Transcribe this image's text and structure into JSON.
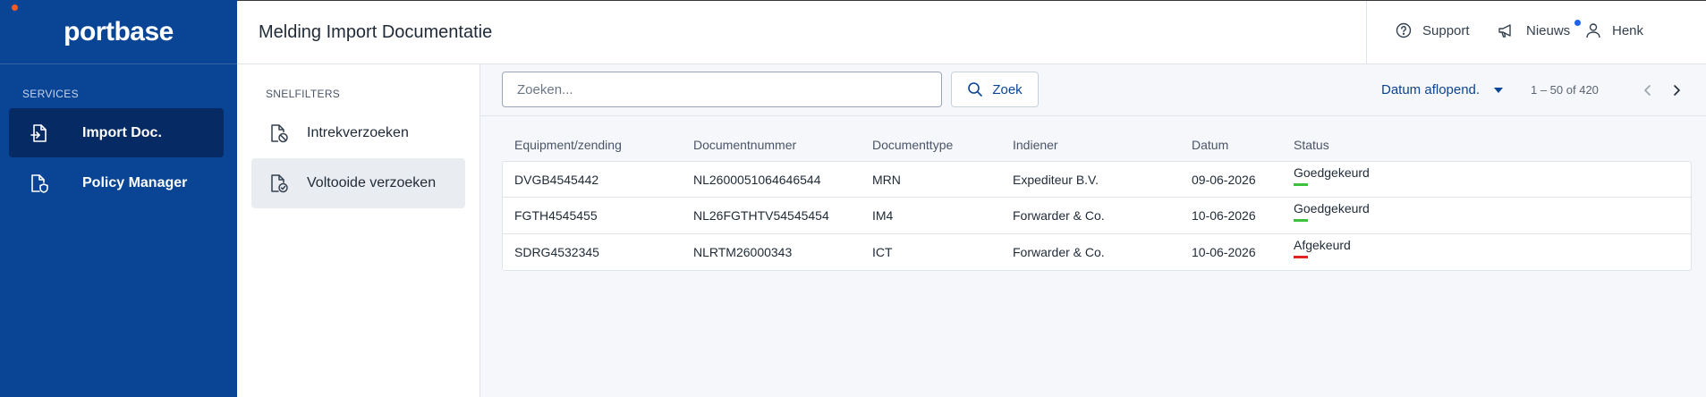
{
  "sidebar": {
    "logo": "portbase",
    "section_label": "SERVICES",
    "items": [
      {
        "label": "Import Doc.",
        "icon": "document-import-icon"
      },
      {
        "label": "Policy Manager",
        "icon": "document-shield-icon"
      }
    ]
  },
  "header": {
    "title": "Melding Import Documentatie",
    "support_label": "Support",
    "news_label": "Nieuws",
    "user_label": "Henk"
  },
  "filters": {
    "title": "SNELFILTERS",
    "items": [
      {
        "label": "Intrekverzoeken",
        "icon": "document-cancel-icon"
      },
      {
        "label": "Voltooide verzoeken",
        "icon": "document-check-icon"
      }
    ]
  },
  "toolbar": {
    "search_placeholder": "Zoeken...",
    "search_button_label": "Zoek",
    "sort_label": "Datum aflopend.",
    "range_text": "1 – 50 of 420"
  },
  "table": {
    "columns": [
      "Equipment/zending",
      "Documentnummer",
      "Documenttype",
      "Indiener",
      "Datum",
      "Status"
    ],
    "rows": [
      {
        "equipment": "DVGB4545442",
        "document_number": "NL2600051064646544",
        "document_type": "MRN",
        "submitter": "Expediteur B.V.",
        "date": "09-06-2026",
        "status": "Goedgekeurd",
        "status_color": "#3cc13b"
      },
      {
        "equipment": "FGTH4545455",
        "document_number": "NL26FGTHTV54545454",
        "document_type": "IM4",
        "submitter": "Forwarder & Co.",
        "date": "10-06-2026",
        "status": "Goedgekeurd",
        "status_color": "#3cc13b"
      },
      {
        "equipment": "SDRG4532345",
        "document_number": "NLRTM26000343",
        "document_type": "ICT",
        "submitter": "Forwarder & Co.",
        "date": "10-06-2026",
        "status": "Afgekeurd",
        "status_color": "#e02424"
      }
    ]
  },
  "colors": {
    "brand": "#0a4494",
    "sidebar_active": "#062a63",
    "logo_accent": "#ff5a1f",
    "notification": "#1e63e9"
  }
}
